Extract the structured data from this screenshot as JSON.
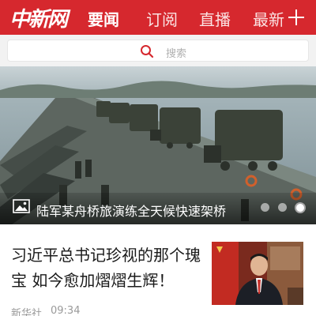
{
  "header": {
    "logo": "中新网",
    "tabs": [
      {
        "label": "要闻",
        "active": true
      },
      {
        "label": "订阅",
        "active": false
      },
      {
        "label": "直播",
        "active": false
      },
      {
        "label": "最新",
        "active": false
      }
    ],
    "background_color": "#d6282e"
  },
  "search": {
    "placeholder": "搜索"
  },
  "banner": {
    "caption": "陆军某舟桥旅演练全天候快速架桥",
    "slide_count": 3,
    "active_slide": 3
  },
  "article": {
    "title": "习近平总书记珍视的那个瑰宝 如今愈加熠熠生辉！",
    "source": "新华社",
    "time": "09:34"
  }
}
